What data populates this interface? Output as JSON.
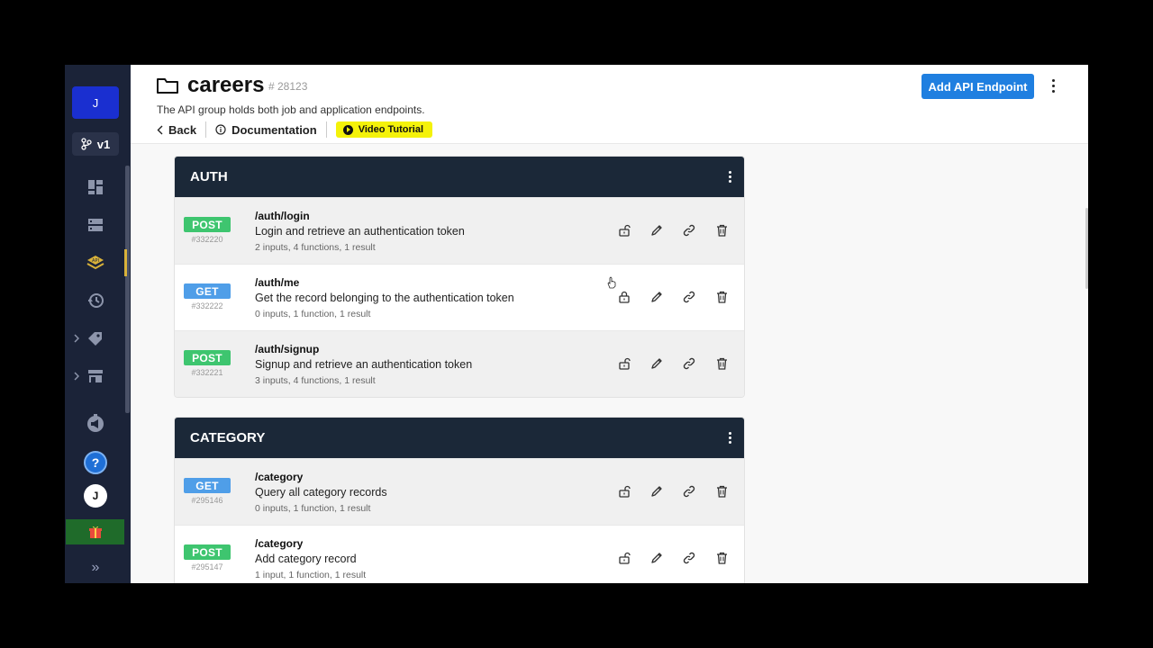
{
  "sidebar": {
    "avatar_initial": "J",
    "branch_label": "v1",
    "user_initial": "J",
    "help_label": "?",
    "expand_label": "»"
  },
  "header": {
    "title": "careers",
    "id": "# 28123",
    "description": "The API group holds both job and application endpoints.",
    "back_label": "Back",
    "documentation_label": "Documentation",
    "video_label": "Video Tutorial",
    "add_button_label": "Add API Endpoint"
  },
  "groups": [
    {
      "name": "AUTH",
      "endpoints": [
        {
          "method": "POST",
          "id": "#332220",
          "path": "/auth/login",
          "description": "Login and retrieve an authentication token",
          "meta": "2 inputs, 4 functions, 1 result",
          "locked": false
        },
        {
          "method": "GET",
          "id": "#332222",
          "path": "/auth/me",
          "description": "Get the record belonging to the authentication token",
          "meta": "0 inputs, 1 function, 1 result",
          "locked": true
        },
        {
          "method": "POST",
          "id": "#332221",
          "path": "/auth/signup",
          "description": "Signup and retrieve an authentication token",
          "meta": "3 inputs, 4 functions, 1 result",
          "locked": false
        }
      ]
    },
    {
      "name": "CATEGORY",
      "endpoints": [
        {
          "method": "GET",
          "id": "#295146",
          "path": "/category",
          "description": "Query all category records",
          "meta": "0 inputs, 1 function, 1 result",
          "locked": false
        },
        {
          "method": "POST",
          "id": "#295147",
          "path": "/category",
          "description": "Add category record",
          "meta": "1 input, 1 function, 1 result",
          "locked": false
        }
      ]
    }
  ],
  "colors": {
    "sidebar_bg": "#1b2338",
    "group_header_bg": "#1b2838",
    "post_badge": "#3ec56f",
    "get_badge": "#4f9ee8",
    "primary_button": "#1f7fe0",
    "video_button": "#f4f20a"
  }
}
